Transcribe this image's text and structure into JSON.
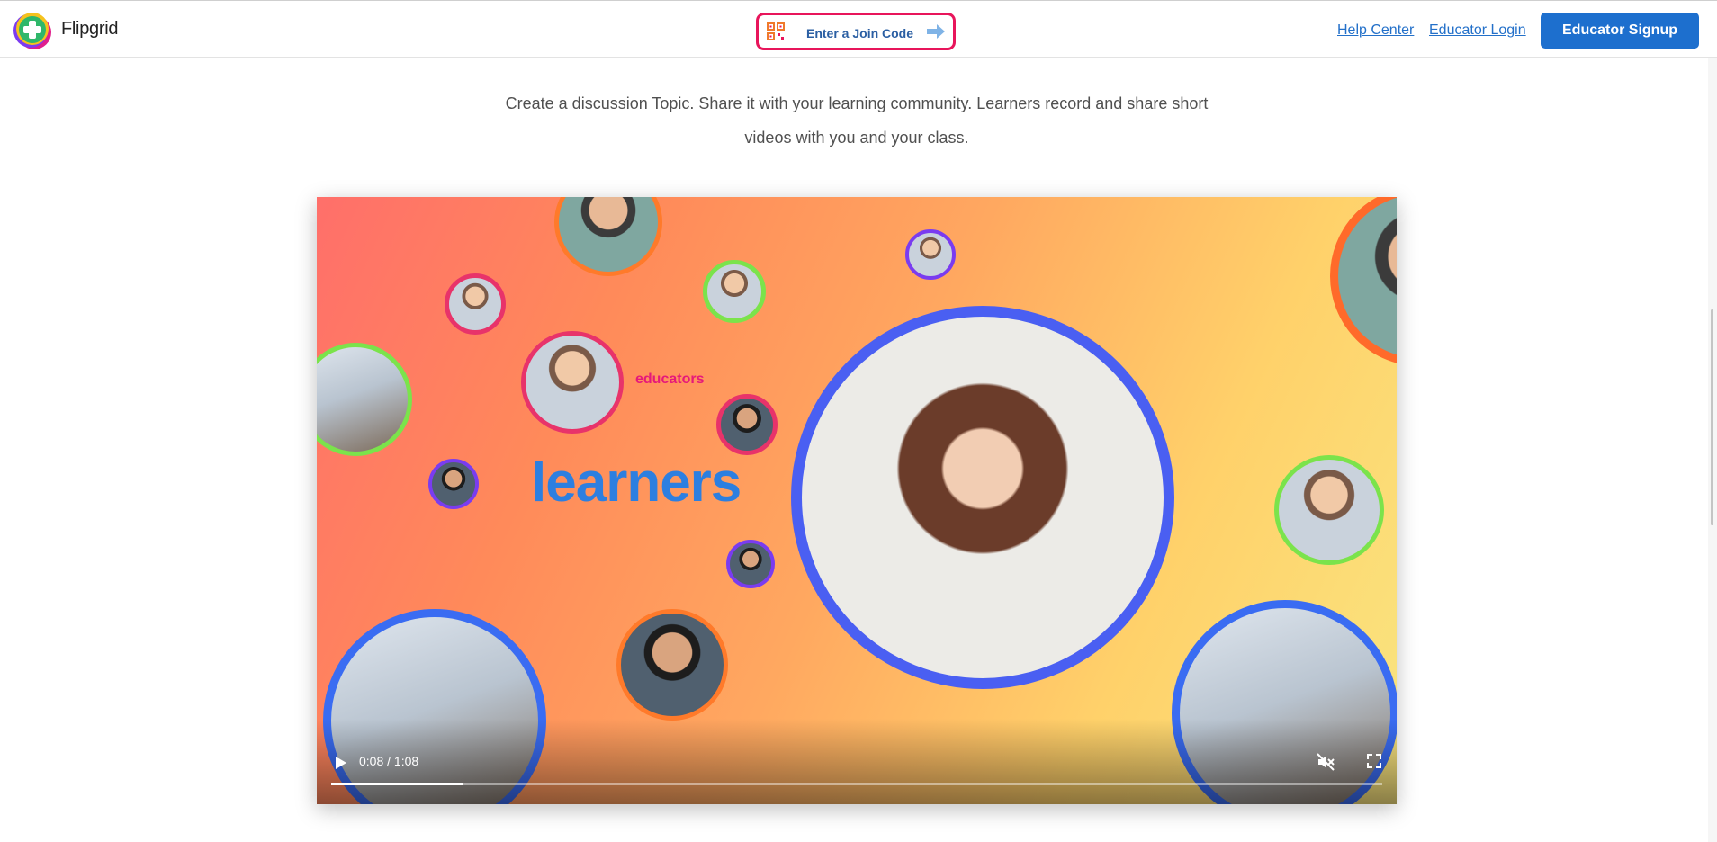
{
  "header": {
    "brand": "Flipgrid",
    "join_code_label": "Enter a Join Code",
    "help_center": "Help Center",
    "educator_login": "Educator Login",
    "educator_signup": "Educator Signup"
  },
  "intro": {
    "line1": "Create a discussion Topic. Share it with your learning community. Learners record and share short",
    "line2": "videos with you and your class."
  },
  "video": {
    "label_educators": "educators",
    "label_learners": "learners",
    "time": "0:08 / 1:08",
    "progress": 0.125
  },
  "colors": {
    "accent": "#1d6fce",
    "join_border": "#e8155b",
    "learners_text": "#2d7fe0",
    "educators_text": "#e6197a"
  }
}
